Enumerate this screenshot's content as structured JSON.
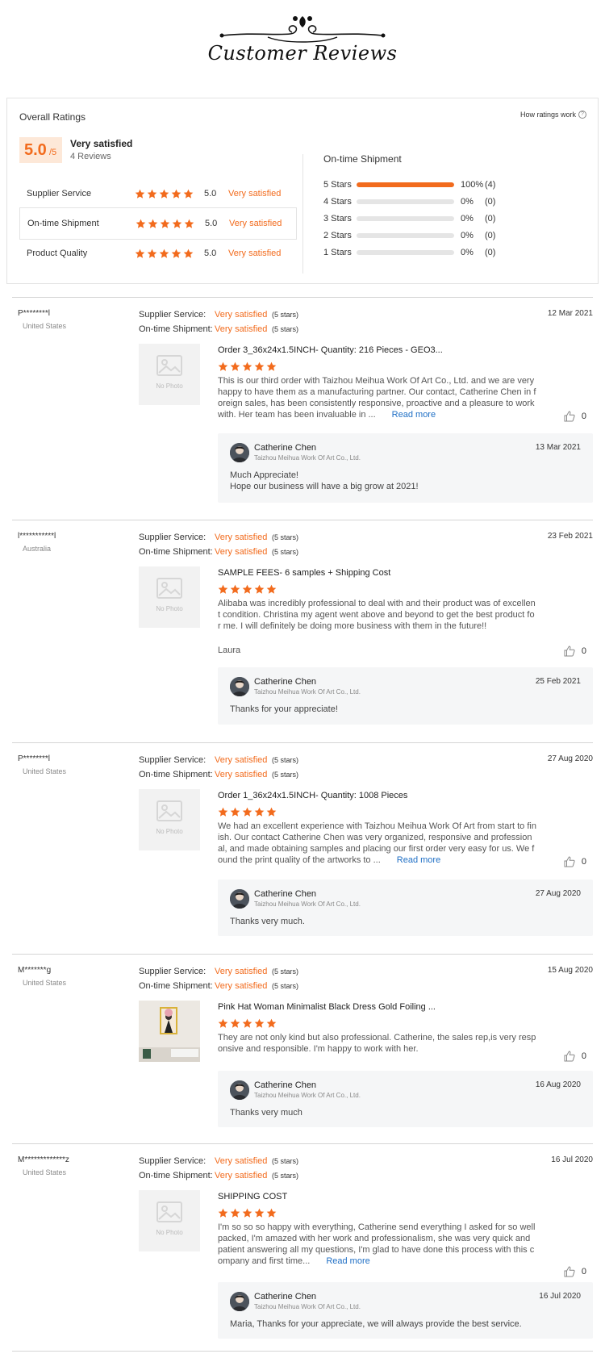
{
  "header": {
    "title": "Customer Reviews"
  },
  "overall": {
    "title": "Overall Ratings",
    "how_link": "How ratings work",
    "score": "5.0",
    "score_max": "/5",
    "summary": "Very satisfied",
    "reviews_count": "4 Reviews",
    "dimensions": [
      {
        "label": "Supplier Service",
        "stars": 5,
        "value": "5.0",
        "satisfaction": "Very satisfied"
      },
      {
        "label": "On-time Shipment",
        "stars": 5,
        "value": "5.0",
        "satisfaction": "Very satisfied"
      },
      {
        "label": "Product Quality",
        "stars": 5,
        "value": "5.0",
        "satisfaction": "Very satisfied"
      }
    ],
    "shipment": {
      "title": "On-time Shipment",
      "rows": [
        {
          "label": "5 Stars",
          "fraction": 1.0,
          "pct": "100%",
          "count": "(4)"
        },
        {
          "label": "4 Stars",
          "fraction": 0,
          "pct": "0%",
          "count": "(0)"
        },
        {
          "label": "3 Stars",
          "fraction": 0,
          "pct": "0%",
          "count": "(0)"
        },
        {
          "label": "2 Stars",
          "fraction": 0,
          "pct": "0%",
          "count": "(0)"
        },
        {
          "label": "1 Stars",
          "fraction": 0,
          "pct": "0%",
          "count": "(0)"
        }
      ]
    }
  },
  "labels": {
    "supplier_service": "Supplier Service:",
    "ontime_shipment": "On-time Shipment:",
    "no_photo": "No Photo",
    "read_more": "Read more"
  },
  "reviews": [
    {
      "name": "P********l",
      "country": "United States",
      "date": "12 Mar 2021",
      "supplier_sat": "Very satisfied",
      "supplier_stars": "(5 stars)",
      "shipment_sat": "Very satisfied",
      "shipment_stars": "(5 stars)",
      "product": "Order 3_36x24x1.5INCH- Quantity: 216 Pieces - GEO3...",
      "rating": 5,
      "text": "This is our third order with Taizhou Meihua Work Of Art Co., Ltd. and we are very happy to have them as a manufacturing partner. Our contact, Catherine Chen in foreign sales, has been consistently responsive, proactive and a pleasure to work with. Her team has been invaluable in ...",
      "signature": "",
      "likes": "0",
      "reply": {
        "name": "Catherine Chen",
        "company": "Taizhou Meihua Work Of Art Co., Ltd.",
        "date": "13 Mar 2021",
        "text": "Much Appreciate!\nHope our business will have a big grow at 2021!"
      }
    },
    {
      "name": "l***********l",
      "country": "Australia",
      "date": "23 Feb 2021",
      "supplier_sat": "Very satisfied",
      "supplier_stars": "(5 stars)",
      "shipment_sat": "Very satisfied",
      "shipment_stars": "(5 stars)",
      "product": "SAMPLE FEES- 6 samples + Shipping Cost",
      "rating": 5,
      "text": "Alibaba was incredibly professional to deal with and their product was of excellent condition. Christina my agent went above and beyond to get the best product for me. I will definitely be doing more business with them in the future!!",
      "signature": "Laura",
      "likes": "0",
      "reply": {
        "name": "Catherine Chen",
        "company": "Taizhou Meihua Work Of Art Co., Ltd.",
        "date": "25 Feb 2021",
        "text": "Thanks for your appreciate!"
      }
    },
    {
      "name": "P********l",
      "country": "United States",
      "date": "27 Aug 2020",
      "supplier_sat": "Very satisfied",
      "supplier_stars": "(5 stars)",
      "shipment_sat": "Very satisfied",
      "shipment_stars": "(5 stars)",
      "product": "Order 1_36x24x1.5INCH- Quantity: 1008 Pieces",
      "rating": 5,
      "text": "We had an excellent experience with Taizhou Meihua Work Of Art from start to finish. Our contact Catherine Chen was very organized, responsive and professional, and made obtaining samples and placing our first order very easy for us. We found the print quality of the artworks to ...",
      "signature": "",
      "likes": "0",
      "reply": {
        "name": "Catherine Chen",
        "company": "Taizhou Meihua Work Of Art Co., Ltd.",
        "date": "27 Aug 2020",
        "text": "Thanks very much."
      }
    },
    {
      "name": "M*******g",
      "country": "United States",
      "date": "15 Aug 2020",
      "supplier_sat": "Very satisfied",
      "supplier_stars": "(5 stars)",
      "shipment_sat": "Very satisfied",
      "shipment_stars": "(5 stars)",
      "product": "Pink Hat Woman Minimalist Black Dress Gold Foiling ...",
      "rating": 5,
      "text": "They are not only kind but also professional. Catherine, the sales rep,is very responsive and responsible. I'm happy to work with her.",
      "signature": "",
      "likes": "0",
      "reply": {
        "name": "Catherine Chen",
        "company": "Taizhou Meihua Work Of Art Co., Ltd.",
        "date": "16 Aug 2020",
        "text": "Thanks very much"
      }
    },
    {
      "name": "M*************z",
      "country": "United States",
      "date": "16 Jul 2020",
      "supplier_sat": "Very satisfied",
      "supplier_stars": "(5 stars)",
      "shipment_sat": "Very satisfied",
      "shipment_stars": "(5 stars)",
      "product": "SHIPPING COST",
      "rating": 5,
      "text": "I'm so so so happy with everything, Catherine send everything I asked for so well packed, I'm amazed with her work and professionalism, she was very quick and patient answering all my questions, I'm glad to have done this process with this company and first time...",
      "signature": "",
      "likes": "0",
      "reply": {
        "name": "Catherine Chen",
        "company": "Taizhou Meihua Work Of Art Co., Ltd.",
        "date": "16 Jul 2020",
        "text": "Maria, Thanks for your appreciate, we will always provide the best service."
      }
    }
  ]
}
